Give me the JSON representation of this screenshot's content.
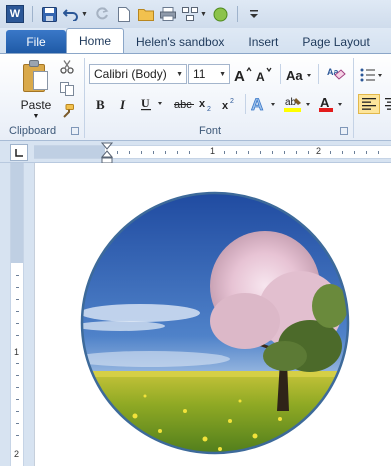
{
  "tabs": [
    {
      "label": "File"
    },
    {
      "label": "Home"
    },
    {
      "label": "Helen's sandbox"
    },
    {
      "label": "Insert"
    },
    {
      "label": "Page Layout"
    }
  ],
  "ribbon": {
    "clipboard": {
      "paste_label": "Paste",
      "group_label": "Clipboard"
    },
    "font": {
      "font_name": "Calibri (Body)",
      "font_size": "11",
      "group_label": "Font"
    }
  },
  "ruler": {
    "h_numbers": [
      "1",
      "1",
      "2"
    ],
    "v_numbers": [
      "1",
      "1",
      "2"
    ]
  },
  "colors": {
    "accent": "#2b5797",
    "file_tab": "#2a66b5",
    "ribbon_bg": "#e8eef7",
    "circle_border": "#3d6a9a"
  }
}
